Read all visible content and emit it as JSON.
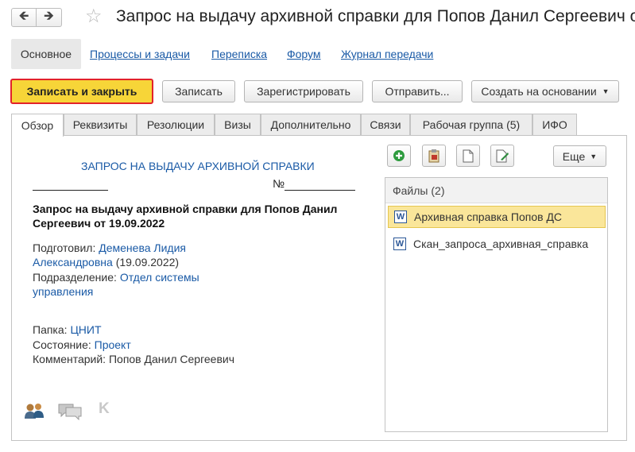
{
  "window": {
    "title": "Запрос на выдачу архивной справки для Попов Данил Сергеевич о"
  },
  "sections": {
    "active": "Основное",
    "links": [
      "Процессы и задачи",
      "Переписка",
      "Форум",
      "Журнал передачи"
    ]
  },
  "toolbar": {
    "save_close": "Записать и закрыть",
    "save": "Записать",
    "register": "Зарегистрировать",
    "send": "Отправить...",
    "create_based": "Создать на основании"
  },
  "tabs": [
    "Обзор",
    "Реквизиты",
    "Резолюции",
    "Визы",
    "Дополнительно",
    "Связи",
    "Рабочая группа (5)",
    "ИФО"
  ],
  "document": {
    "heading": "ЗАПРОС НА ВЫДАЧУ АРХИВНОЙ СПРАВКИ",
    "number_sign": "№",
    "title": "Запрос на выдачу архивной справки для Попов Данил Сергеевич от 19.09.2022",
    "prepared_label": "Подготовил:",
    "prepared_name_1": "Деменева Лидия",
    "prepared_name_2": "Александровна",
    "prepared_date": "(19.09.2022)",
    "department_label": "Подразделение:",
    "department_1": "Отдел системы",
    "department_2": "управления",
    "folder_label": "Папка:",
    "folder_value": "ЦНИТ",
    "state_label": "Состояние:",
    "state_value": "Проект",
    "comment_label": "Комментарий:",
    "comment_value": "Попов Данил Сергеевич"
  },
  "files": {
    "more_label": "Еще",
    "header": "Файлы (2)",
    "items": [
      "Архивная справка Попов ДС",
      "Скан_запроса_архивная_справка"
    ],
    "selected_index": 0,
    "file_icon_letter": "W"
  },
  "colors": {
    "primary_button": "#f7d538",
    "primary_border": "#e2222a",
    "link": "#1a5aa6",
    "selected_row": "#fae69a"
  }
}
